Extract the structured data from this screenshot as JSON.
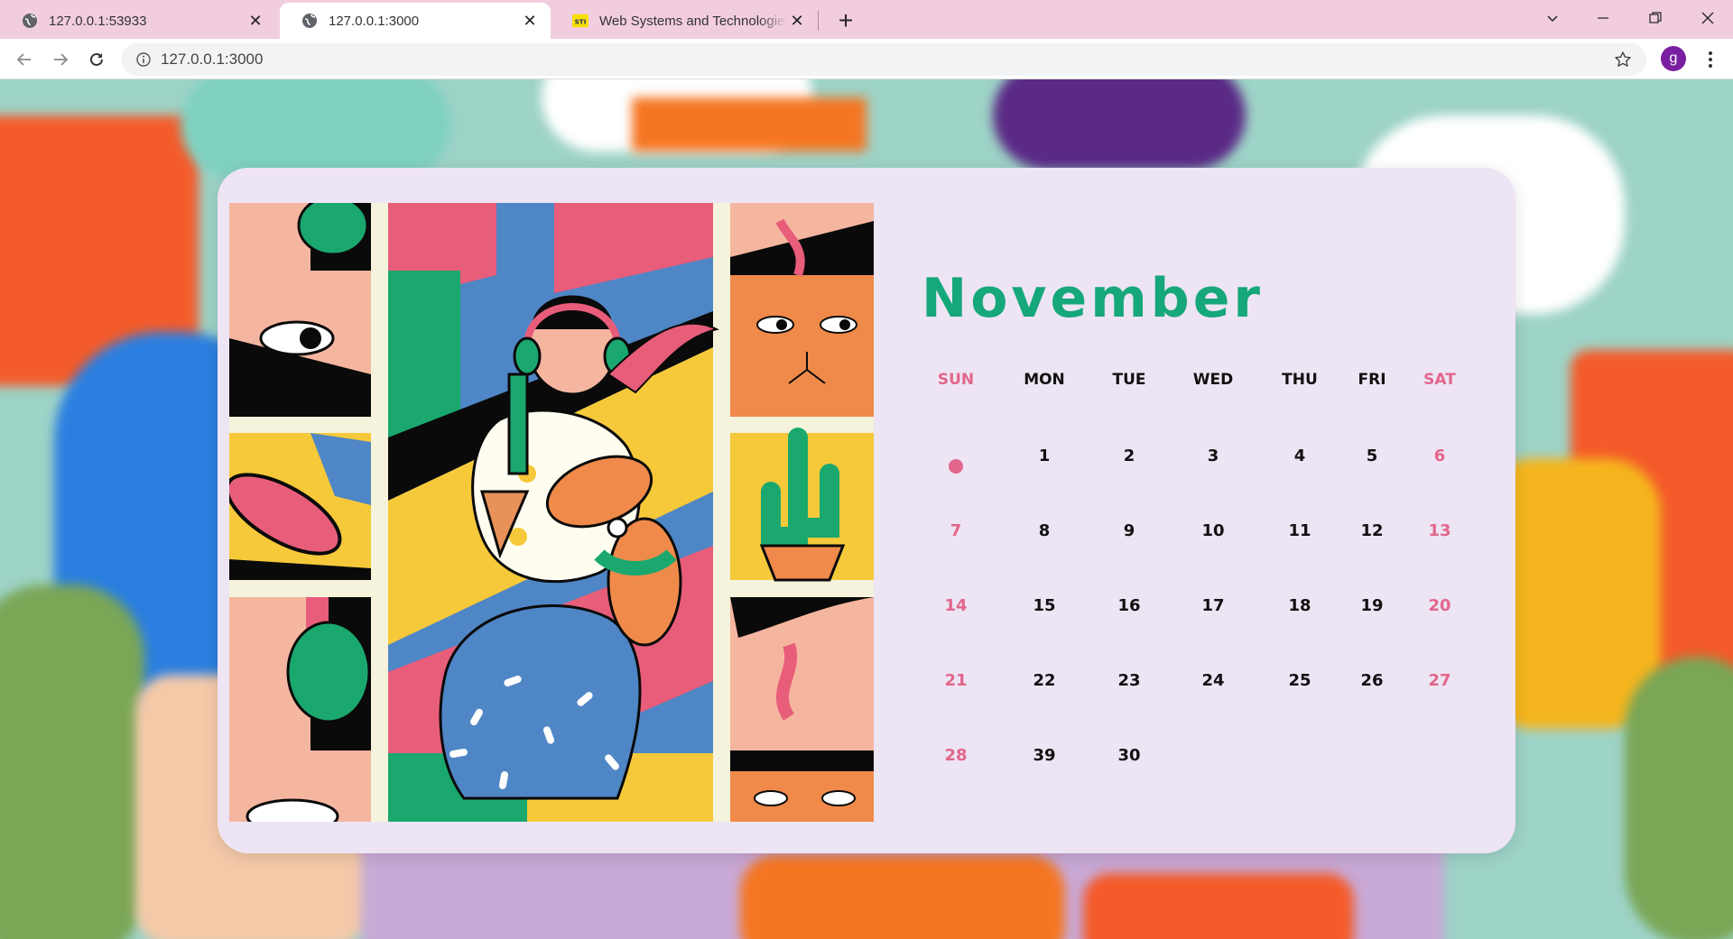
{
  "browser": {
    "tabs": [
      {
        "title": "127.0.0.1:53933",
        "active": false,
        "favicon": "globe-icon"
      },
      {
        "title": "127.0.0.1:3000",
        "active": true,
        "favicon": "globe-icon"
      },
      {
        "title": "Web Systems and Technologies -",
        "active": false,
        "favicon": "sti-logo-icon"
      }
    ],
    "new_tab_label": "+",
    "address": "127.0.0.1:3000",
    "profile_initial": "g",
    "colors": {
      "tabstrip": "#f2cde0",
      "profile": "#7b1fa2"
    }
  },
  "calendar": {
    "month": "November",
    "weekdays": [
      "SUN",
      "MON",
      "TUE",
      "WED",
      "THU",
      "FRI",
      "SAT"
    ],
    "weeks": [
      [
        "•",
        "1",
        "2",
        "3",
        "4",
        "5",
        "6"
      ],
      [
        "7",
        "8",
        "9",
        "10",
        "11",
        "12",
        "13"
      ],
      [
        "14",
        "15",
        "16",
        "17",
        "18",
        "19",
        "20"
      ],
      [
        "21",
        "22",
        "23",
        "24",
        "25",
        "26",
        "27"
      ],
      [
        "28",
        "39",
        "30",
        "",
        "",
        "",
        ""
      ]
    ],
    "colors": {
      "month": "#16a77a",
      "weekend": "#e2668a",
      "card": "#ede4f4"
    }
  }
}
